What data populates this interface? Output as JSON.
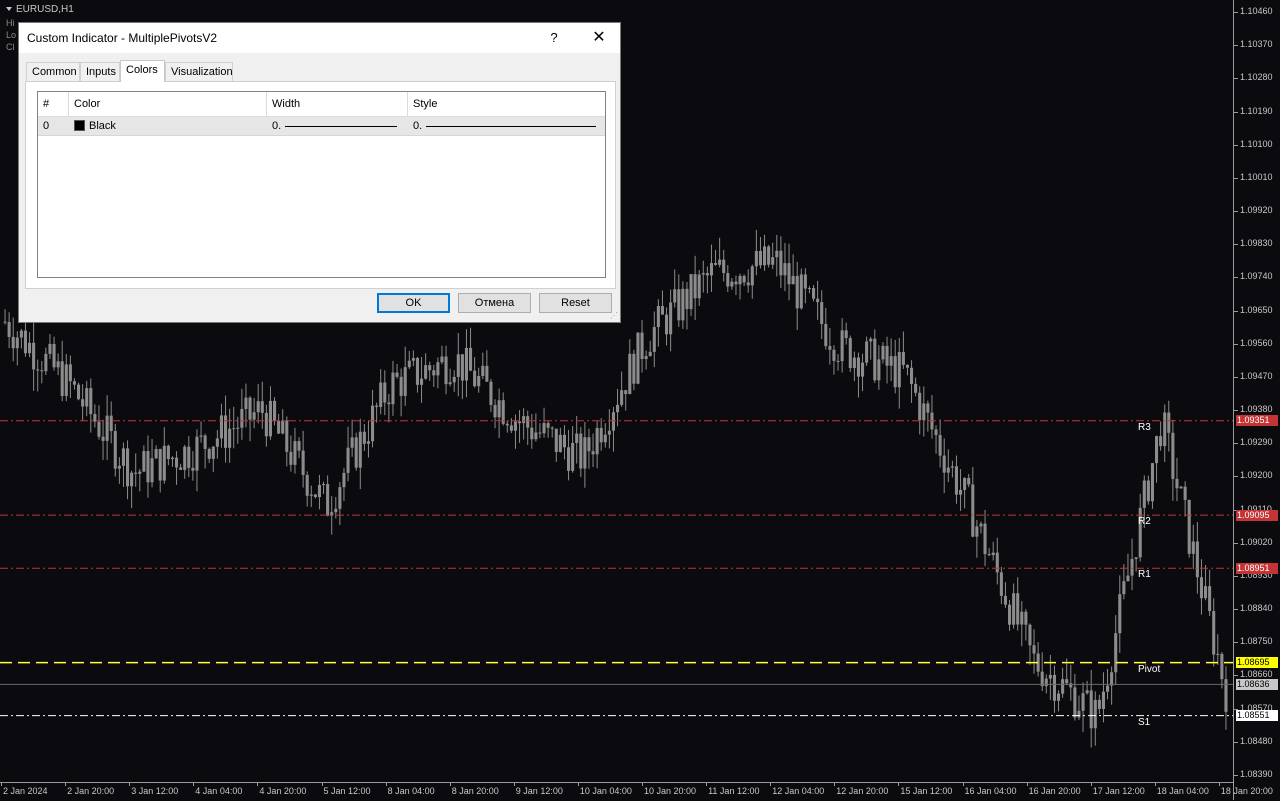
{
  "window": {
    "symbol": "EURUSD,H1",
    "info_lines": [
      "Hi",
      "Lo",
      "Cl"
    ]
  },
  "price_axis": {
    "ticks": [
      "1.10460",
      "1.10370",
      "1.10280",
      "1.10190",
      "1.10100",
      "1.10010",
      "1.09920",
      "1.09830",
      "1.09740",
      "1.09650",
      "1.09560",
      "1.09470",
      "1.09380",
      "1.09290",
      "1.09200",
      "1.09110",
      "1.09020",
      "1.08930",
      "1.08840",
      "1.08750",
      "1.08660",
      "1.08570",
      "1.08480",
      "1.08390"
    ],
    "labels": [
      {
        "name": "r3",
        "text": "1.09351",
        "bg": "#c43434",
        "fg": "#ffffff"
      },
      {
        "name": "r2",
        "text": "1.09095",
        "bg": "#c43434",
        "fg": "#ffffff"
      },
      {
        "name": "r1",
        "text": "1.08951",
        "bg": "#c43434",
        "fg": "#ffffff"
      },
      {
        "name": "pivot",
        "text": "1.08695",
        "bg": "#ffff00",
        "fg": "#000000"
      },
      {
        "name": "current",
        "text": "1.08636",
        "bg": "#c8c8c8",
        "fg": "#000000"
      },
      {
        "name": "s1",
        "text": "1.08551",
        "bg": "#ffffff",
        "fg": "#000000"
      }
    ]
  },
  "time_axis": [
    "2 Jan 2024",
    "2 Jan 20:00",
    "3 Jan 12:00",
    "4 Jan 04:00",
    "4 Jan 20:00",
    "5 Jan 12:00",
    "8 Jan 04:00",
    "8 Jan 20:00",
    "9 Jan 12:00",
    "10 Jan 04:00",
    "10 Jan 20:00",
    "11 Jan 12:00",
    "12 Jan 04:00",
    "12 Jan 20:00",
    "15 Jan 12:00",
    "16 Jan 04:00",
    "16 Jan 20:00",
    "17 Jan 12:00",
    "18 Jan 04:00",
    "18 Jan 20:00"
  ],
  "pivot_levels": [
    {
      "name": "R3",
      "price": 1.09351,
      "color": "#c43434",
      "style": "dashdot"
    },
    {
      "name": "R2",
      "price": 1.09095,
      "color": "#c43434",
      "style": "dashdot"
    },
    {
      "name": "R1",
      "price": 1.08951,
      "color": "#c43434",
      "style": "dashdot"
    },
    {
      "name": "Pivot",
      "price": 1.08695,
      "color": "#ffff33",
      "style": "dash"
    },
    {
      "name": "S1",
      "price": 1.08551,
      "color": "#ffffff",
      "style": "dashdot"
    }
  ],
  "current_price": 1.08636,
  "candle_color": "#8c8c8c",
  "chart_data": {
    "type": "line",
    "title": "EURUSD,H1",
    "xlabel": "",
    "ylabel": "",
    "ylim": [
      1.0839,
      1.1046
    ],
    "x": [
      "2 Jan 2024",
      "2 Jan 20:00",
      "3 Jan 12:00",
      "4 Jan 04:00",
      "4 Jan 20:00",
      "5 Jan 12:00",
      "8 Jan 04:00",
      "8 Jan 20:00",
      "9 Jan 12:00",
      "10 Jan 04:00",
      "10 Jan 20:00",
      "11 Jan 12:00",
      "12 Jan 04:00",
      "12 Jan 20:00",
      "15 Jan 12:00",
      "16 Jan 04:00",
      "16 Jan 20:00",
      "17 Jan 12:00",
      "18 Jan 04:00",
      "18 Jan 20:00"
    ],
    "series": [
      {
        "values": [
          1.0962,
          1.0945,
          1.0921,
          1.0928,
          1.0938,
          1.0912,
          1.0945,
          1.0952,
          1.0935,
          1.0925,
          1.0958,
          1.0975,
          1.0978,
          1.0955,
          1.0948,
          1.0912,
          1.087,
          1.0855,
          1.0935,
          1.0862
        ]
      }
    ],
    "grid": false
  },
  "dialog": {
    "title": "Custom Indicator - MultiplePivotsV2",
    "help_label": "?",
    "close_label": "✕",
    "tabs": [
      "Common",
      "Inputs",
      "Colors",
      "Visualization"
    ],
    "active_tab": "Colors",
    "table": {
      "headers": [
        "#",
        "Color",
        "Width",
        "Style"
      ],
      "rows": [
        {
          "index": "0",
          "color_name": "Black",
          "color_hex": "#000000",
          "width": "0.",
          "style": "0."
        }
      ]
    },
    "buttons": {
      "ok": "OK",
      "cancel": "Отмена",
      "reset": "Reset"
    }
  }
}
